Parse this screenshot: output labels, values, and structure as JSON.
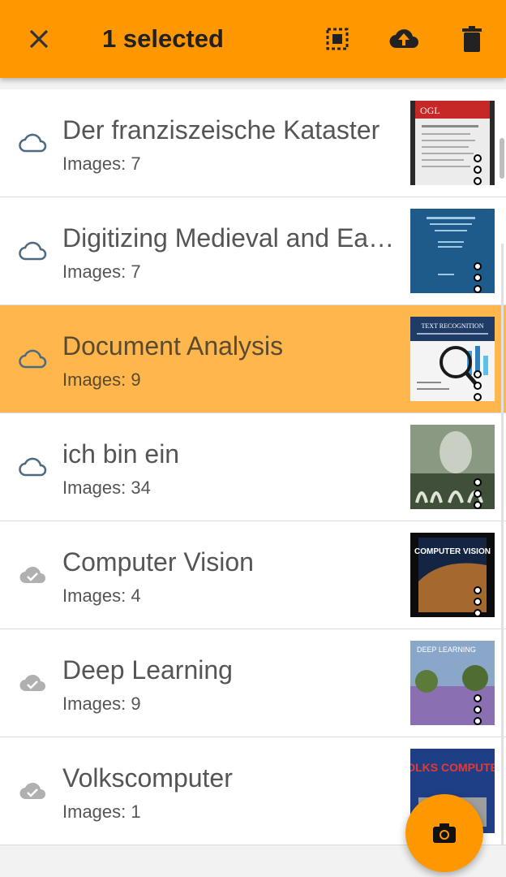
{
  "appbar": {
    "title": "1 selected",
    "background": "#ff9800",
    "icons": [
      "close-icon",
      "select-all-icon",
      "cloud-upload-icon",
      "delete-icon"
    ]
  },
  "documents": [
    {
      "name": "Der franziszeische Kataster",
      "count": "Images: 7",
      "sync": "cloud-outline",
      "selected": false
    },
    {
      "name": "Digitizing Medieval and Ea…",
      "count": "Images: 7",
      "sync": "cloud-outline",
      "selected": false
    },
    {
      "name": "Document Analysis",
      "count": "Images: 9",
      "sync": "cloud-outline",
      "selected": true
    },
    {
      "name": "ich bin ein",
      "count": "Images: 34",
      "sync": "cloud-outline",
      "selected": false
    },
    {
      "name": "Computer Vision",
      "count": "Images: 4",
      "sync": "cloud-done",
      "selected": false
    },
    {
      "name": "Deep Learning",
      "count": "Images: 9",
      "sync": "cloud-done",
      "selected": false
    },
    {
      "name": "Volkscomputer",
      "count": "Images: 1",
      "sync": "cloud-done",
      "selected": false
    }
  ],
  "thumbnails": {
    "t1_text": "OGL",
    "t3_text": "TEXT RECOGNITION",
    "t5_text": "COMPUTER VISION",
    "t6_text": "DEEP LEARNING",
    "t7_text": "VOLKS COMPUTER"
  },
  "fab": {
    "icon": "camera-icon",
    "color": "#ff9800"
  },
  "colors": {
    "selected_row": "#ffb74d",
    "cloud_outline": "#4e6a80",
    "cloud_done": "#b0b0b0"
  }
}
